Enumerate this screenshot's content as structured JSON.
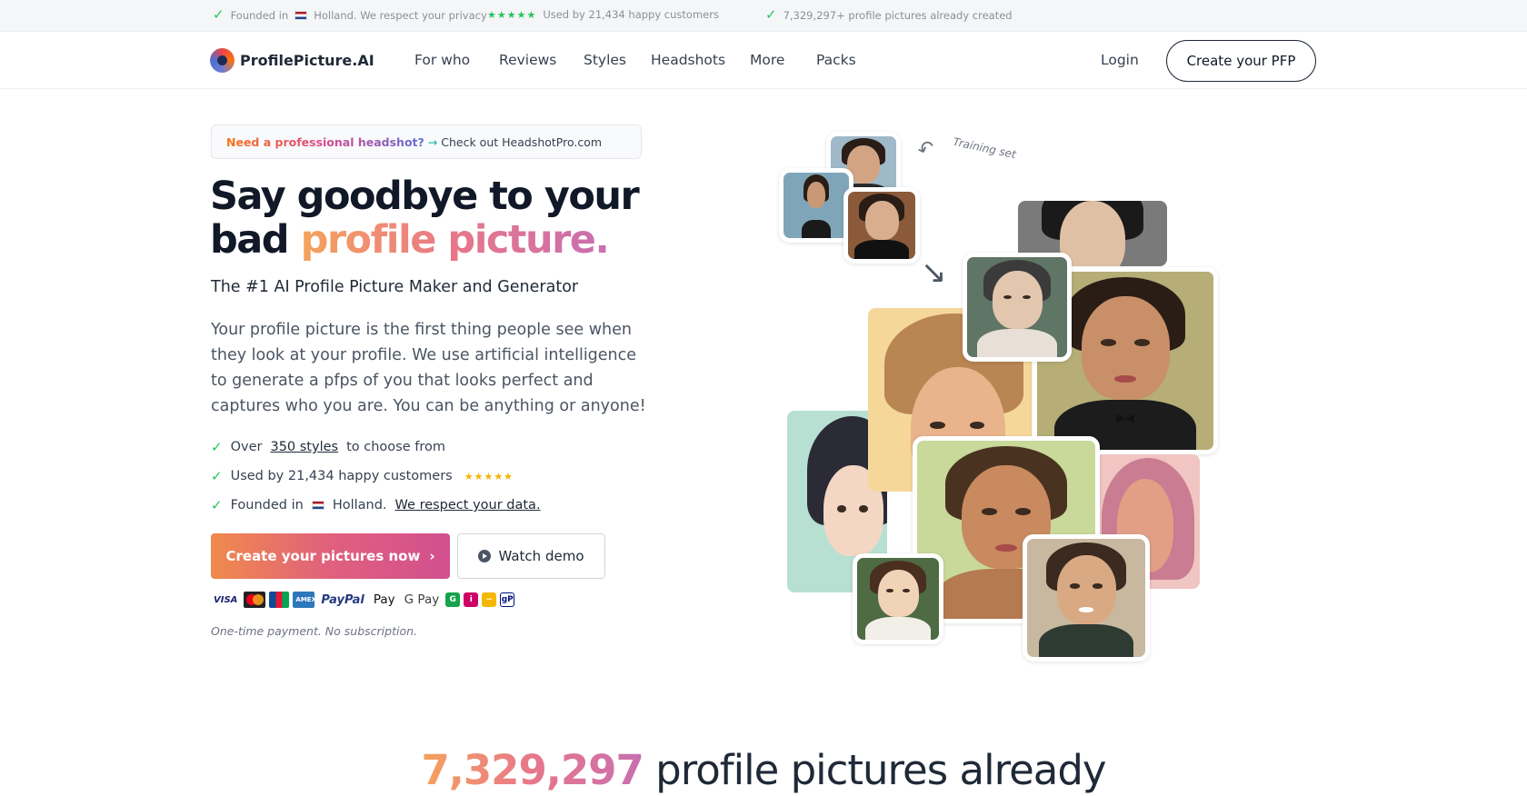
{
  "top_strip": {
    "founded_prefix": "Founded in",
    "founded_country": "Holland. We respect your privacy",
    "stars": "★★★★★",
    "customers": "Used by 21,434 happy customers",
    "created": "7,329,297+ profile pictures already created"
  },
  "nav": {
    "logo": "ProfilePicture.AI",
    "links": [
      "For who",
      "Reviews",
      "Styles",
      "Headshots",
      "More",
      "Packs"
    ],
    "login": "Login",
    "cta": "Create your PFP"
  },
  "hero": {
    "banner_strong": "Need a professional headshot?",
    "banner_arrow": "→",
    "banner_rest": "Check out HeadshotPro.com",
    "headline_line1": "Say goodbye to your",
    "headline_plain": "bad",
    "headline_gradient": "profile picture.",
    "subtitle": "The #1 AI Profile Picture Maker and Generator",
    "paragraph": "Your profile picture is the first thing people see when they look at your profile. We use artificial intelligence to generate a pfps of you that looks perfect and captures who you are. You can be anything or anyone!",
    "bullets": {
      "b1_prefix": "Over",
      "b1_link": "350 styles",
      "b1_suffix": "to choose from",
      "b2_text": "Used by 21,434 happy customers",
      "b2_stars": "★★★★★",
      "b3_prefix": "Founded in",
      "b3_country": "Holland.",
      "b3_link": "We respect your data."
    },
    "primary_button": "Create your pictures now",
    "primary_chevron": "›",
    "secondary_button": "Watch demo",
    "payments": {
      "visa": "VISA",
      "amex": "AMEX",
      "paypal": "PayPal",
      "apple_pay": " Pay",
      "google_pay": "G Pay"
    },
    "payment_note": "One-time payment. No subscription."
  },
  "collage": {
    "training_label": "Training set"
  },
  "counter": {
    "number": "7,329,297",
    "text": "profile pictures already"
  },
  "colors": {
    "accent_gradient_start": "#f5a35c",
    "accent_gradient_end": "#c86fb0",
    "check_green": "#22c55e",
    "star_yellow": "#f4b400"
  }
}
